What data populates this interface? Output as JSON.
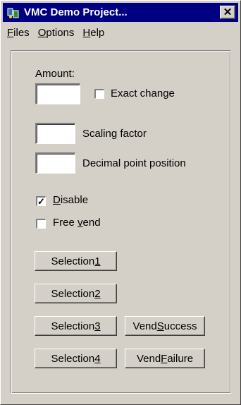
{
  "window": {
    "title": "VMC Demo Project...",
    "close_symbol": "✕",
    "app_icon": "vmc-app-icon"
  },
  "menu": {
    "items": [
      {
        "pre": "",
        "key": "F",
        "post": "iles"
      },
      {
        "pre": "",
        "key": "O",
        "post": "ptions"
      },
      {
        "pre": "",
        "key": "H",
        "post": "elp"
      }
    ]
  },
  "form": {
    "amount_label": "Amount:",
    "amount_value": "",
    "exact_change_label": "Exact change",
    "exact_change_checked": false,
    "scaling_value": "",
    "scaling_label": "Scaling factor",
    "decimal_value": "",
    "decimal_label": "Decimal point position",
    "disable": {
      "pre": "",
      "key": "D",
      "post": "isable",
      "checked": true
    },
    "free_vend": {
      "pre": "Free ",
      "key": "v",
      "post": "end",
      "checked": false
    }
  },
  "buttons": {
    "sel1": {
      "pre": "Selection ",
      "key": "1",
      "post": ""
    },
    "sel2": {
      "pre": "Selection ",
      "key": "2",
      "post": ""
    },
    "sel3": {
      "pre": "Selection ",
      "key": "3",
      "post": ""
    },
    "sel4": {
      "pre": "Selection ",
      "key": "4",
      "post": ""
    },
    "vend_success": {
      "pre": "Vend ",
      "key": "S",
      "post": "uccess"
    },
    "vend_failure": {
      "pre": "Vend ",
      "key": "F",
      "post": "ailure"
    }
  },
  "colors": {
    "titlebar": "#000080",
    "face": "#d4d0c8"
  }
}
